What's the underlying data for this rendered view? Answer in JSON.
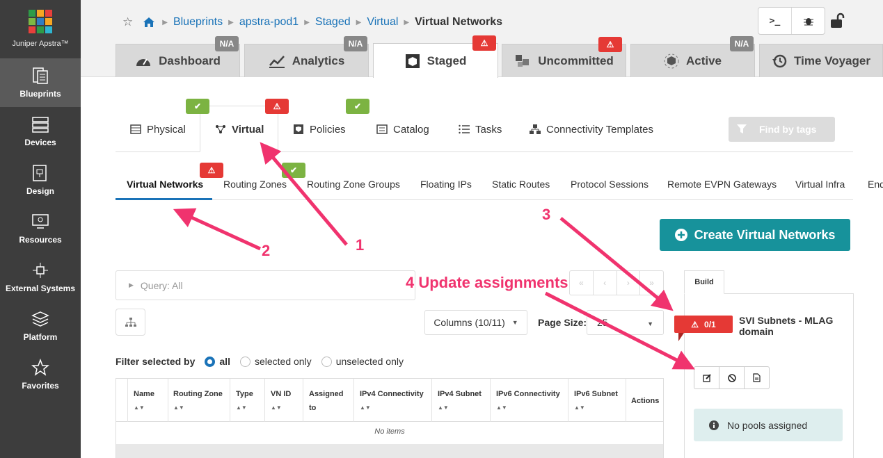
{
  "app": {
    "name": "Juniper Apstra™"
  },
  "leftnav": {
    "items": [
      {
        "label": "Blueprints",
        "icon": "blueprints-icon",
        "active": true
      },
      {
        "label": "Devices",
        "icon": "devices-icon"
      },
      {
        "label": "Design",
        "icon": "design-icon"
      },
      {
        "label": "Resources",
        "icon": "resources-icon"
      },
      {
        "label": "External Systems",
        "icon": "external-systems-icon"
      },
      {
        "label": "Platform",
        "icon": "platform-icon"
      },
      {
        "label": "Favorites",
        "icon": "star-icon"
      }
    ]
  },
  "breadcrumb": {
    "items": [
      "Blueprints",
      "apstra-pod1",
      "Staged",
      "Virtual"
    ],
    "current": "Virtual Networks"
  },
  "maintabs": [
    {
      "label": "Dashboard",
      "badge": "N/A"
    },
    {
      "label": "Analytics",
      "badge": "N/A"
    },
    {
      "label": "Staged",
      "badge": "warning"
    },
    {
      "label": "Uncommitted",
      "badge": "warning"
    },
    {
      "label": "Active",
      "badge": "N/A"
    },
    {
      "label": "Time Voyager"
    }
  ],
  "subtabs": [
    {
      "label": "Physical",
      "status": "ok"
    },
    {
      "label": "Virtual",
      "status": "warning"
    },
    {
      "label": "Policies",
      "status": "ok"
    },
    {
      "label": "Catalog"
    },
    {
      "label": "Tasks"
    },
    {
      "label": "Connectivity Templates"
    }
  ],
  "find_by_tags": "Find by tags",
  "tabs3": [
    "Virtual Networks",
    "Routing Zones",
    "Routing Zone Groups",
    "Floating IPs",
    "Static Routes",
    "Protocol Sessions",
    "Remote EVPN Gateways",
    "Virtual Infra",
    "End"
  ],
  "create_button": "Create Virtual Networks",
  "query": "Query: All",
  "columns_button": "Columns (10/11)",
  "page_size": {
    "label": "Page Size:",
    "value": "25"
  },
  "filter": {
    "label": "Filter selected by",
    "options": [
      "all",
      "selected only",
      "unselected only"
    ],
    "selected": "all"
  },
  "table": {
    "headers": [
      [
        "Name"
      ],
      [
        "Routing Zone"
      ],
      [
        "Type"
      ],
      [
        "VN ID"
      ],
      [
        "Assigned",
        "to"
      ],
      [
        "IPv4 Connectivity"
      ],
      [
        "IPv4 Subnet"
      ],
      [
        "IPv6 Connectivity"
      ],
      [
        "IPv6 Subnet"
      ],
      [
        "Actions"
      ]
    ],
    "empty": "No items"
  },
  "build": {
    "tab": "Build",
    "error_count": "0/1",
    "resource": "SVI Subnets - MLAG domain",
    "no_pools": "No pools assigned"
  },
  "annotations": {
    "a1": "1",
    "a2": "2",
    "a3": "3",
    "a4": "4 Update assignments"
  },
  "colors": {
    "accent": "#1a73b8",
    "create": "#17929b",
    "error": "#e53935",
    "ok": "#7cb342",
    "annotation": "#f0336e"
  }
}
